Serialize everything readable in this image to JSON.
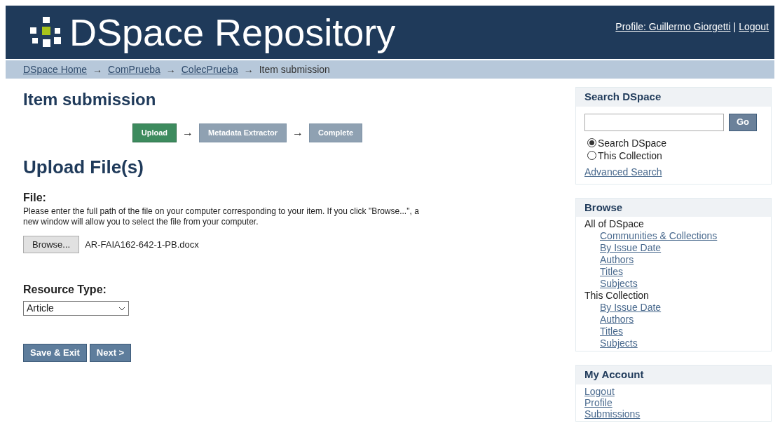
{
  "header": {
    "title": "DSpace Repository",
    "profile_link": "Profile: Guillermo Giorgetti",
    "separator": "|",
    "logout_link": "Logout"
  },
  "breadcrumb": {
    "links": [
      "DSpace Home",
      "ComPrueba",
      "ColecPrueba"
    ],
    "current": "Item submission",
    "arrow": "→"
  },
  "page_title": "Item submission",
  "steps": [
    {
      "label": "Upload",
      "selected": true
    },
    {
      "label": "Metadata Extractor",
      "selected": false
    },
    {
      "label": "Complete",
      "selected": false
    }
  ],
  "section_title": "Upload File(s)",
  "file": {
    "label": "File:",
    "help": "Please enter the full path of the file on your computer corresponding to your item. If you click \"Browse...\", a new window will allow you to select the file from your computer.",
    "browse_button": "Browse...",
    "file_name": "AR-FAIA162-642-1-PB.docx"
  },
  "resource_type": {
    "label": "Resource Type:",
    "value": "Article"
  },
  "buttons": [
    "Save & Exit",
    "Next >"
  ],
  "sidebar": {
    "search": {
      "title": "Search DSpace",
      "go": "Go",
      "options": [
        {
          "label": "Search DSpace",
          "selected": true
        },
        {
          "label": "This Collection",
          "selected": false
        }
      ],
      "advanced": "Advanced Search"
    },
    "browse": {
      "title": "Browse",
      "groups": [
        {
          "label": "All of DSpace",
          "links": [
            "Communities & Collections",
            "By Issue Date",
            "Authors",
            "Titles",
            "Subjects"
          ]
        },
        {
          "label": "This Collection",
          "links": [
            "By Issue Date",
            "Authors",
            "Titles",
            "Subjects"
          ]
        }
      ]
    },
    "account": {
      "title": "My Account",
      "links": [
        "Logout",
        "Profile",
        "Submissions"
      ]
    }
  }
}
